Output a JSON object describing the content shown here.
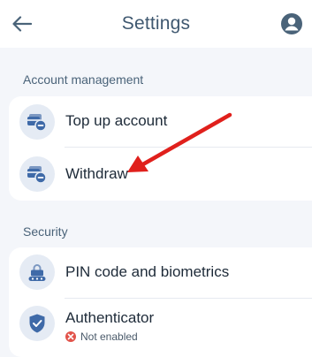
{
  "header": {
    "title": "Settings",
    "back_icon": "arrow-left-icon",
    "profile_icon": "user-avatar-icon"
  },
  "sections": [
    {
      "label": "Account management",
      "items": [
        {
          "label": "Top up account",
          "icon": "card-plus-icon"
        },
        {
          "label": "Withdraw",
          "icon": "card-minus-icon"
        }
      ]
    },
    {
      "label": "Security",
      "items": [
        {
          "label": "PIN code and biometrics",
          "icon": "lock-keypad-icon"
        },
        {
          "label": "Authenticator",
          "icon": "shield-check-icon",
          "status": "Not enabled"
        }
      ]
    }
  ],
  "colors": {
    "accent": "#3f6aa8",
    "icon_background": "#e5ebf4",
    "annotation_arrow": "#e0201c",
    "status_error": "#e2534a"
  }
}
